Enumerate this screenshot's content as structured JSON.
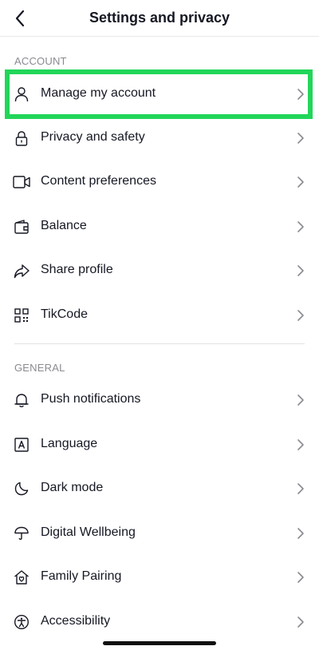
{
  "header": {
    "title": "Settings and privacy"
  },
  "sections": [
    {
      "label": "ACCOUNT",
      "items": [
        {
          "label": "Manage my account",
          "icon": "person-icon"
        },
        {
          "label": "Privacy and safety",
          "icon": "lock-icon"
        },
        {
          "label": "Content preferences",
          "icon": "video-icon"
        },
        {
          "label": "Balance",
          "icon": "wallet-icon"
        },
        {
          "label": "Share profile",
          "icon": "share-icon"
        },
        {
          "label": "TikCode",
          "icon": "qr-code-icon"
        }
      ]
    },
    {
      "label": "GENERAL",
      "items": [
        {
          "label": "Push notifications",
          "icon": "bell-icon"
        },
        {
          "label": "Language",
          "icon": "language-icon"
        },
        {
          "label": "Dark mode",
          "icon": "moon-icon"
        },
        {
          "label": "Digital Wellbeing",
          "icon": "umbrella-icon"
        },
        {
          "label": "Family Pairing",
          "icon": "house-heart-icon"
        },
        {
          "label": "Accessibility",
          "icon": "accessibility-icon"
        }
      ]
    }
  ],
  "colors": {
    "highlight": "#21d659",
    "text": "#161823",
    "section_label": "#8a8b91"
  }
}
